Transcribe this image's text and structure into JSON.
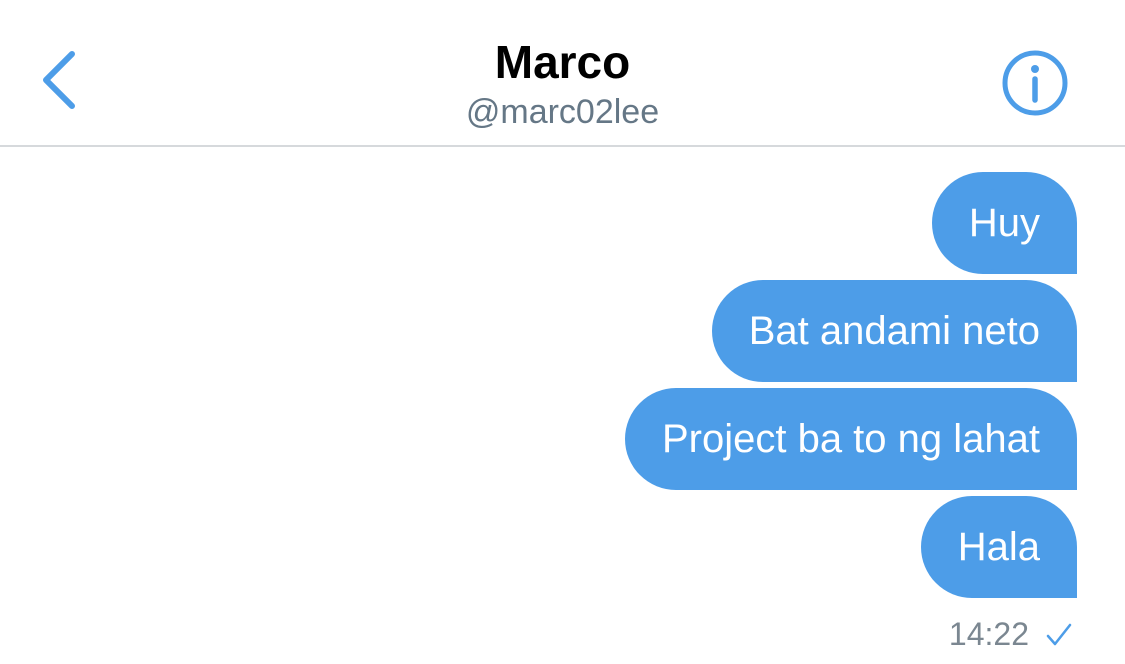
{
  "header": {
    "name": "Marco",
    "handle": "@marc02lee"
  },
  "messages": [
    {
      "text": "Huy"
    },
    {
      "text": "Bat andami neto"
    },
    {
      "text": "Project ba to ng lahat"
    },
    {
      "text": "Hala"
    }
  ],
  "status": {
    "time": "14:22",
    "read_icon": "checkmark-icon"
  },
  "icons": {
    "back": "chevron-left-icon",
    "info": "info-icon"
  },
  "colors": {
    "accent": "#4d9de8",
    "bubble_text": "#ffffff",
    "secondary_text": "#657786",
    "divider": "#d6d9dc"
  }
}
